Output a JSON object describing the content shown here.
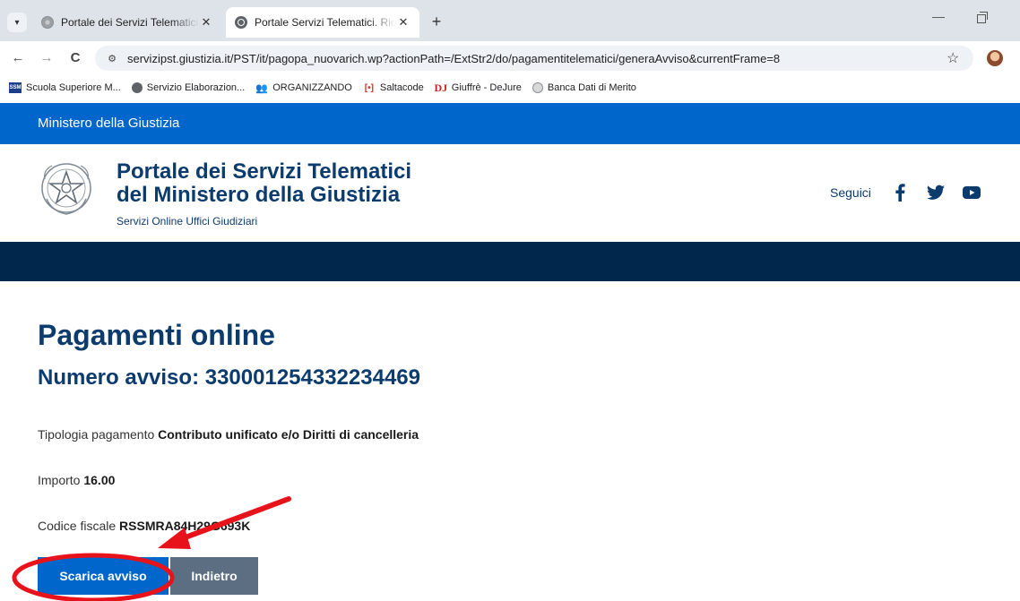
{
  "browser": {
    "tabs": [
      {
        "title": "Portale dei Servizi Telematici de",
        "active": false
      },
      {
        "title": "Portale Servizi Telematici. Richie",
        "active": true
      }
    ],
    "tab_close": "✕",
    "new_tab": "+",
    "back": "←",
    "forward": "→",
    "reload": "C",
    "url": "servizipst.giustizia.it/PST/it/pagopa_nuovarich.wp?actionPath=/ExtStr2/do/pagamentitelematici/generaAvviso&currentFrame=8",
    "bookmark_star": "☆",
    "bookmarks": [
      {
        "label": "Scuola Superiore M...",
        "icon": "ssm-icon"
      },
      {
        "label": "Servizio Elaborazion...",
        "icon": "globe-icon"
      },
      {
        "label": "ORGANIZZANDO",
        "icon": "people-icon"
      },
      {
        "label": "Saltacode",
        "icon": "saltacode-icon"
      },
      {
        "label": "Giuffrè - DeJure",
        "icon": "dejure-icon"
      },
      {
        "label": "Banca Dati di Merito",
        "icon": "banca-icon"
      }
    ]
  },
  "page": {
    "gov_bar": "Ministero della Giustizia",
    "site_title_line1": "Portale dei Servizi Telematici",
    "site_title_line2": "del Ministero della Giustizia",
    "site_subtitle": "Servizi Online Uffici Giudiziari",
    "social_label": "Seguici",
    "social_icons": [
      "facebook-icon",
      "twitter-icon",
      "youtube-icon"
    ],
    "title": "Pagamenti online",
    "notice_number": "Numero avviso: 330001254332234469",
    "fields": [
      {
        "label": "Tipologia pagamento",
        "value": "Contributo unificato e/o Diritti di cancelleria"
      },
      {
        "label": "Importo",
        "value": "16.00"
      },
      {
        "label": "Codice fiscale",
        "value": "RSSMRA84H29G693K"
      }
    ],
    "buttons": {
      "download": "Scarica avviso",
      "back": "Indietro"
    }
  },
  "colors": {
    "primary_blue": "#0066cc",
    "dark_navy": "#01274c",
    "title_blue": "#0c3b6e",
    "secondary_button": "#5c6f82",
    "annotation_red": "#e8131a"
  }
}
